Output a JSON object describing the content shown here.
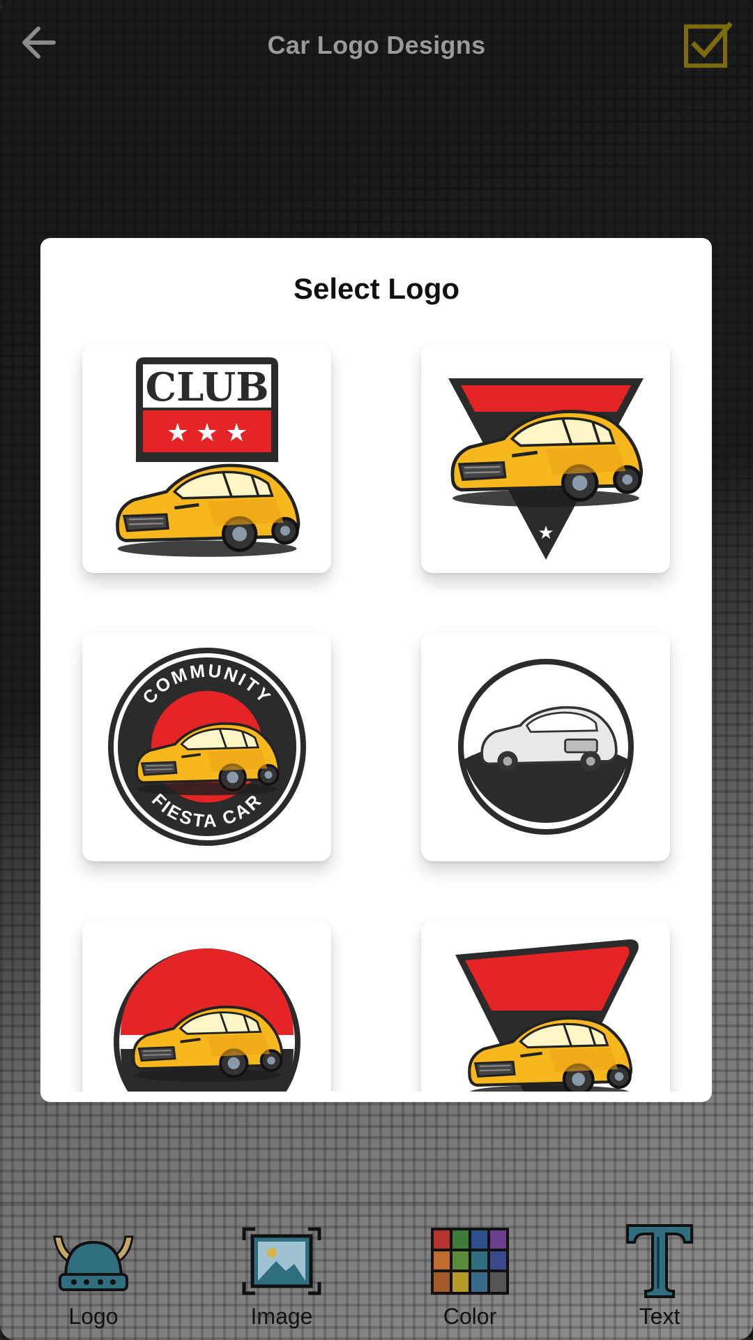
{
  "header": {
    "title": "Car Logo Designs"
  },
  "dialog": {
    "title": "Select Logo",
    "logos": [
      {
        "text_top": "CLUB",
        "name": "club-car-logo"
      },
      {
        "name": "triangle-car-logo"
      },
      {
        "text_top": "COMMUNITY",
        "text_bottom": "FIESTA CAR",
        "name": "community-badge-logo"
      },
      {
        "name": "circle-silver-car-logo"
      },
      {
        "name": "red-circle-car-logo"
      },
      {
        "name": "red-shield-car-logo"
      }
    ]
  },
  "toolbar": {
    "items": [
      {
        "label": "Logo",
        "icon": "viking-helmet-icon"
      },
      {
        "label": "Image",
        "icon": "image-icon"
      },
      {
        "label": "Color",
        "icon": "color-palette-icon"
      },
      {
        "label": "Text",
        "icon": "text-t-icon"
      }
    ]
  },
  "colors": {
    "accent_yellow": "#7c6a0f",
    "car_yellow": "#f6b81c",
    "logo_red": "#e52425",
    "logo_dark": "#2b2b2b"
  }
}
